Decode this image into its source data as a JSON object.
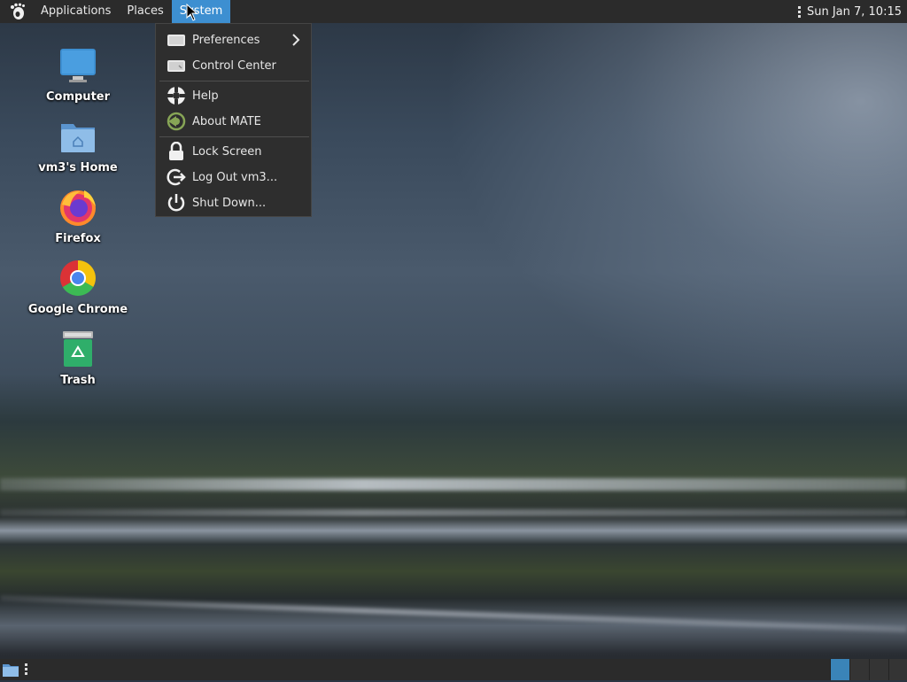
{
  "top_panel": {
    "menus": [
      "Applications",
      "Places",
      "System"
    ],
    "active_menu": "System",
    "clock": "Sun Jan  7, 10:15"
  },
  "system_menu": {
    "items": [
      {
        "label": "Preferences",
        "icon": "preferences-icon",
        "has_submenu": true
      },
      {
        "label": "Control Center",
        "icon": "control-center-icon"
      },
      {
        "label": "Help",
        "icon": "help-icon"
      },
      {
        "label": "About MATE",
        "icon": "mate-logo-icon"
      },
      {
        "label": "Lock Screen",
        "icon": "lock-icon"
      },
      {
        "label": "Log Out vm3...",
        "icon": "logout-icon"
      },
      {
        "label": "Shut Down...",
        "icon": "power-icon"
      }
    ]
  },
  "desktop": {
    "icons": [
      {
        "label": "Computer",
        "icon": "computer-icon"
      },
      {
        "label": "vm3's Home",
        "icon": "home-folder-icon"
      },
      {
        "label": "Firefox",
        "icon": "firefox-icon"
      },
      {
        "label": "Google Chrome",
        "icon": "chrome-icon"
      },
      {
        "label": "Trash",
        "icon": "trash-icon"
      }
    ]
  },
  "bottom_panel": {
    "workspaces": 4,
    "active_workspace": 1
  },
  "colors": {
    "panel": "#2b2b2b",
    "accent": "#3d8fd1",
    "menu_bg": "#2e2e2e"
  }
}
